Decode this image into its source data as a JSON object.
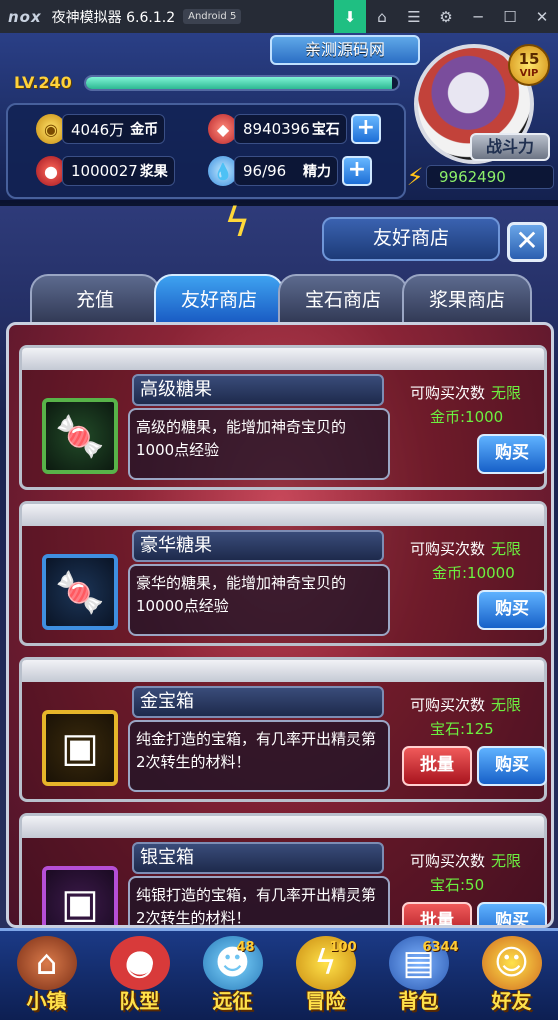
{
  "emulator": {
    "logo": "nox",
    "title": "夜神模拟器 6.6.1.2",
    "android": "Android 5",
    "icons": [
      "tray-icon",
      "shirt-icon",
      "menu-icon",
      "gear-icon",
      "minimize-icon",
      "maximize-icon",
      "close-icon"
    ]
  },
  "hud": {
    "source_banner": "亲测源码网",
    "level": "LV.240",
    "exp_fraction": 0.98,
    "gold": {
      "value": "4046万",
      "label": "金币"
    },
    "gems": {
      "value": "8940396",
      "label": "宝石"
    },
    "berries": {
      "value": "1000027",
      "label": "浆果"
    },
    "energy": {
      "value": "96/96",
      "label": "精力"
    },
    "vip_level": "15",
    "vip_text": "VIP",
    "battle_label": "战斗力",
    "battle_power": "9962490"
  },
  "shop": {
    "title": "友好商店",
    "tabs": [
      {
        "label": "充值",
        "active": false
      },
      {
        "label": "友好商店",
        "active": true
      },
      {
        "label": "宝石商店",
        "active": false
      },
      {
        "label": "浆果商店",
        "active": false
      }
    ],
    "items": [
      {
        "name": "高级糖果",
        "desc": "高级的糖果，能增加神奇宝贝的1000点经验",
        "limit_label": "可购买次数",
        "limit_value": "无限",
        "price": "金币:1000",
        "buy": "购买",
        "icon": "candy-icon"
      },
      {
        "name": "豪华糖果",
        "desc": "豪华的糖果，能增加神奇宝贝的10000点经验",
        "limit_label": "可购买次数",
        "limit_value": "无限",
        "price": "金币:10000",
        "buy": "购买",
        "icon": "deluxe-candy-icon"
      },
      {
        "name": "金宝箱",
        "desc": "纯金打造的宝箱，有几率开出精灵第2次转生的材料！",
        "limit_label": "可购买次数",
        "limit_value": "无限",
        "price": "宝石:125",
        "buy": "购买",
        "bulk": "批量",
        "icon": "gold-chest-icon"
      },
      {
        "name": "银宝箱",
        "desc": "纯银打造的宝箱，有几率开出精灵第2次转生的材料！",
        "limit_label": "可购买次数",
        "limit_value": "无限",
        "price": "宝石:50",
        "buy": "购买",
        "bulk": "批量",
        "icon": "silver-chest-icon"
      }
    ]
  },
  "nav": [
    {
      "label": "小镇",
      "badge": "",
      "icon": "town-icon"
    },
    {
      "label": "队型",
      "badge": "",
      "icon": "pokeball-icon"
    },
    {
      "label": "远征",
      "badge": "48",
      "icon": "expedition-icon"
    },
    {
      "label": "冒险",
      "badge": "100",
      "icon": "adventure-icon"
    },
    {
      "label": "背包",
      "badge": "6344",
      "icon": "backpack-icon"
    },
    {
      "label": "好友",
      "badge": "",
      "icon": "friends-icon"
    }
  ]
}
